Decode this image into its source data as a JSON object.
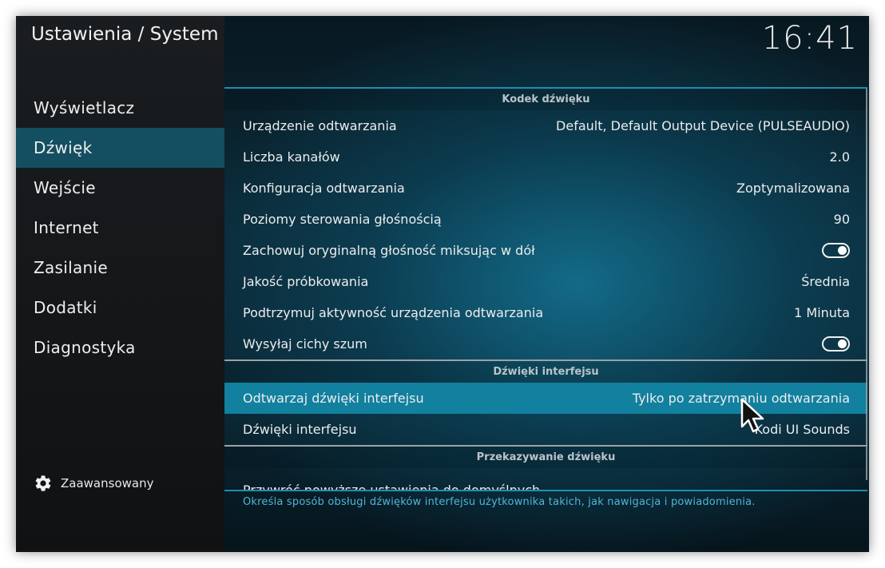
{
  "header": {
    "title": "Ustawienia / System",
    "clock": "16:41"
  },
  "sidebar": {
    "items": [
      {
        "label": "Wyświetlacz"
      },
      {
        "label": "Dźwięk",
        "active": true
      },
      {
        "label": "Wejście"
      },
      {
        "label": "Internet"
      },
      {
        "label": "Zasilanie"
      },
      {
        "label": "Dodatki"
      },
      {
        "label": "Diagnostyka"
      }
    ],
    "advanced": {
      "icon": "gear-icon",
      "label": "Zaawansowany"
    }
  },
  "settings": {
    "audio_codec": {
      "title": "Kodek dźwięku",
      "rows": [
        {
          "label": "Urządzenie odtwarzania",
          "value": "Default, Default Output Device (PULSEAUDIO)"
        },
        {
          "label": "Liczba kanałów",
          "value": "2.0"
        },
        {
          "label": "Konfiguracja odtwarzania",
          "value": "Zoptymalizowana"
        },
        {
          "label": "Poziomy sterowania głośnością",
          "value": "90"
        },
        {
          "label": "Zachowuj oryginalną głośność miksując w dół",
          "toggle": true
        },
        {
          "label": "Jakość próbkowania",
          "value": "Średnia"
        },
        {
          "label": "Podtrzymuj aktywność urządzenia odtwarzania",
          "value": "1 Minuta"
        },
        {
          "label": "Wysyłaj cichy szum",
          "toggle": true
        }
      ]
    },
    "gui_sounds": {
      "title": "Dźwięki interfejsu",
      "rows": [
        {
          "label": "Odtwarzaj dźwięki interfejsu",
          "value": "Tylko po zatrzymaniu odtwarzania",
          "focused": true
        },
        {
          "label": "Dźwięki interfejsu",
          "value": "Kodi UI Sounds"
        }
      ]
    },
    "passthrough": {
      "title": "Przekazywanie dźwięku",
      "rows": [
        {
          "label": "Przywróć powyższe ustawienia do domyślnych"
        }
      ]
    }
  },
  "description": "Określa sposób obsługi dźwięków interfejsu użytkownika takich, jak nawigacja i powiadomienia.",
  "colors": {
    "accent": "#1f8eb0",
    "focus": "#12809f",
    "sidebar_active": "#134f60",
    "description_text": "#52b4d6"
  }
}
